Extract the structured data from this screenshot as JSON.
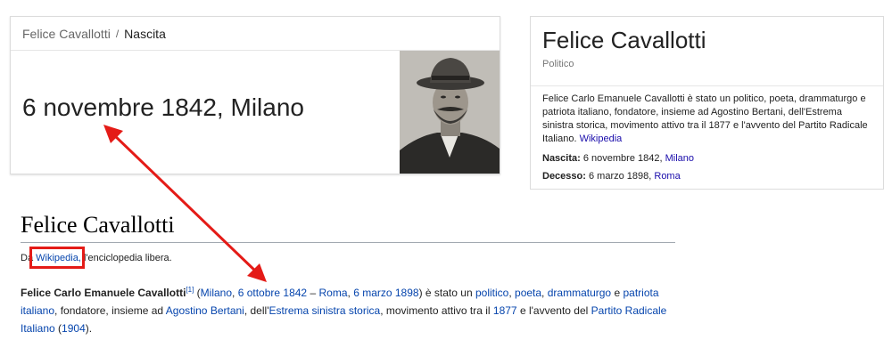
{
  "answer_card": {
    "breadcrumb_parent": "Felice Cavallotti",
    "breadcrumb_sep": "/",
    "breadcrumb_current": "Nascita",
    "answer": "6 novembre 1842, Milano"
  },
  "knowledge_panel": {
    "title": "Felice Cavallotti",
    "subtitle": "Politico",
    "description": "Felice Carlo Emanuele Cavallotti è stato un politico, poeta, drammaturgo e patriota italiano, fondatore, insieme ad Agostino Bertani, dell'Estrema sinistra storica, movimento attivo tra il 1877 e l'avvento del Partito Radicale Italiano.",
    "source_link": "Wikipedia",
    "birth_label": "Nascita:",
    "birth_date": "6 novembre 1842,",
    "birth_place": "Milano",
    "death_label": "Decesso:",
    "death_date": "6 marzo 1898,",
    "death_place": "Roma"
  },
  "wiki": {
    "title": "Felice Cavallotti",
    "from_prefix": "Da",
    "from_link": "Wikipedia,",
    "from_suffix": "l'enciclopedia libera.",
    "name_bold": "Felice Carlo Emanuele Cavallotti",
    "ref": "[1]",
    "t_open": "(",
    "l_milano": "Milano",
    "t_c1": ",",
    "l_6ott": "6 ottobre 1842",
    "t_dash": "–",
    "l_roma": "Roma",
    "t_c2": ",",
    "l_6mar": "6 marzo 1898",
    "t_estato": ") è stato un",
    "l_politico": "politico",
    "t_c3": ",",
    "l_poeta": "poeta",
    "t_c4": ",",
    "l_dramm": "drammaturgo",
    "t_e": "e",
    "l_patriota": "patriota italiano",
    "t_fond": ", fondatore, insieme ad",
    "l_bertani": "Agostino Bertani",
    "t_dell": ", dell'",
    "l_estrema": "Estrema sinistra storica",
    "t_mov": ", movimento attivo tra il",
    "l_1877": "1877",
    "t_avv": "e l'avvento del",
    "l_partito": "Partito Radicale Italiano",
    "t_paren": "(",
    "l_1904": "1904",
    "t_end": ")."
  },
  "colors": {
    "annotation_red": "#e41b17",
    "link_blue": "#1a0dab"
  },
  "icons": {
    "portrait": "person-portrait-image"
  }
}
